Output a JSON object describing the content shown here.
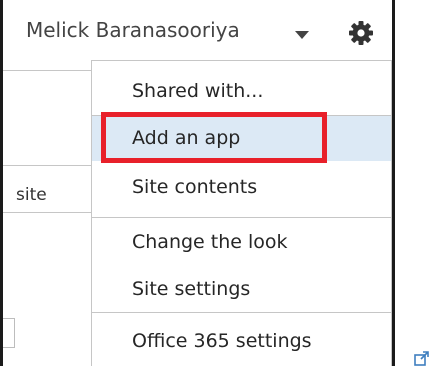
{
  "header": {
    "user_name": "Melick Baranasooriya"
  },
  "background": {
    "site_label": "site"
  },
  "settings_menu": {
    "items": [
      {
        "label": "Shared with..."
      },
      {
        "label": "Add an app"
      },
      {
        "label": "Site contents"
      },
      {
        "label": "Change the look"
      },
      {
        "label": "Site settings"
      },
      {
        "label": "Office 365 settings"
      }
    ],
    "highlighted_item": "Add an app"
  },
  "colors": {
    "highlight_border": "#e8202a",
    "hover_background": "#dce9f5",
    "text": "#262626",
    "user_text": "#444444",
    "frame": "#1a1a1a",
    "separator": "#c6c6c6",
    "external_link_icon": "#3f7fbf"
  },
  "icons": {
    "settings": "gear-icon",
    "user_menu": "caret-down-icon",
    "external": "external-link-icon"
  }
}
